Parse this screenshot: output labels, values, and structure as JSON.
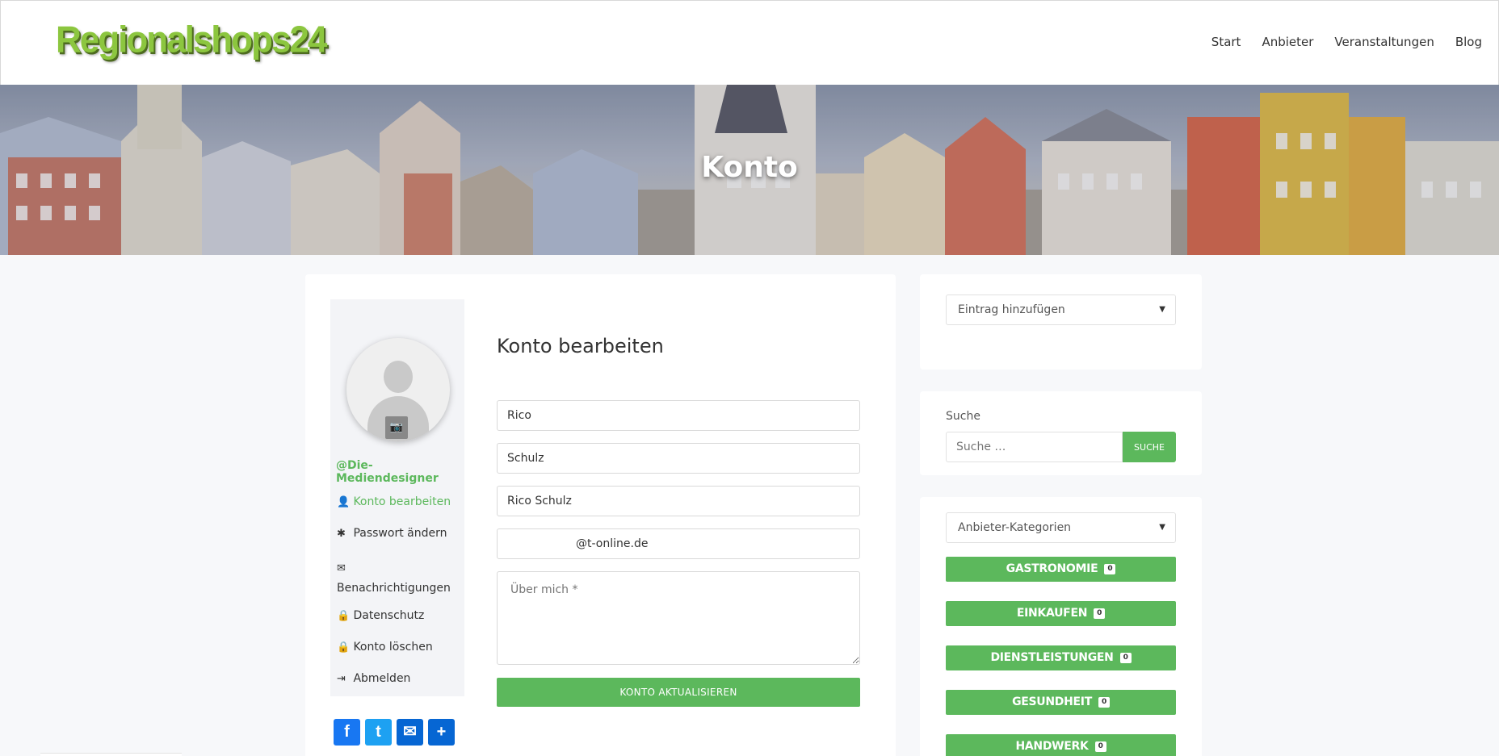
{
  "header": {
    "logo": "Regionalshops24",
    "nav": [
      "Start",
      "Anbieter",
      "Veranstaltungen",
      "Blog"
    ]
  },
  "hero": {
    "title": "Konto"
  },
  "account": {
    "username": "@Die-Mediendesigner",
    "menu": [
      {
        "label": "Konto bearbeiten",
        "icon": "user-icon",
        "glyph": "👤",
        "active": true
      },
      {
        "label": "Passwort ändern",
        "icon": "asterisk-icon",
        "glyph": "✱"
      },
      {
        "label": "Benachrichtigungen",
        "icon": "envelope-icon",
        "glyph": "✉"
      },
      {
        "label": "Datenschutz",
        "icon": "lock-icon",
        "glyph": "🔒"
      },
      {
        "label": "Konto löschen",
        "icon": "lock-icon",
        "glyph": "🔒"
      },
      {
        "label": "Abmelden",
        "icon": "sign-out-icon",
        "glyph": "⇥"
      }
    ],
    "share": [
      {
        "label": "f",
        "icon": "facebook-icon"
      },
      {
        "label": "t",
        "icon": "twitter-icon"
      },
      {
        "label": "✉",
        "icon": "email-icon"
      },
      {
        "label": "+",
        "icon": "share-plus-icon"
      }
    ],
    "form": {
      "title": "Konto bearbeiten",
      "first_name": "Rico",
      "last_name": "Schulz",
      "display_name": "Rico Schulz",
      "email": "@t-online.de",
      "about_placeholder": "Über mich *",
      "submit_label": "KONTO AKTUALISIEREN"
    }
  },
  "widgets": {
    "add_entry": "Eintrag hinzufügen",
    "search": {
      "label": "Suche",
      "placeholder": "Suche …",
      "button": "SUCHE"
    },
    "categories_select": "Anbieter-Kategorien",
    "categories": [
      {
        "name": "GASTRONOMIE",
        "count": "0"
      },
      {
        "name": "EINKAUFEN",
        "count": "0"
      },
      {
        "name": "DIENSTLEISTUNGEN",
        "count": "0"
      },
      {
        "name": "GESUNDHEIT",
        "count": "0"
      },
      {
        "name": "HANDWERK",
        "count": "0"
      }
    ]
  },
  "colors": {
    "accent": "#5cb85c",
    "logo": "#8cc63f"
  }
}
